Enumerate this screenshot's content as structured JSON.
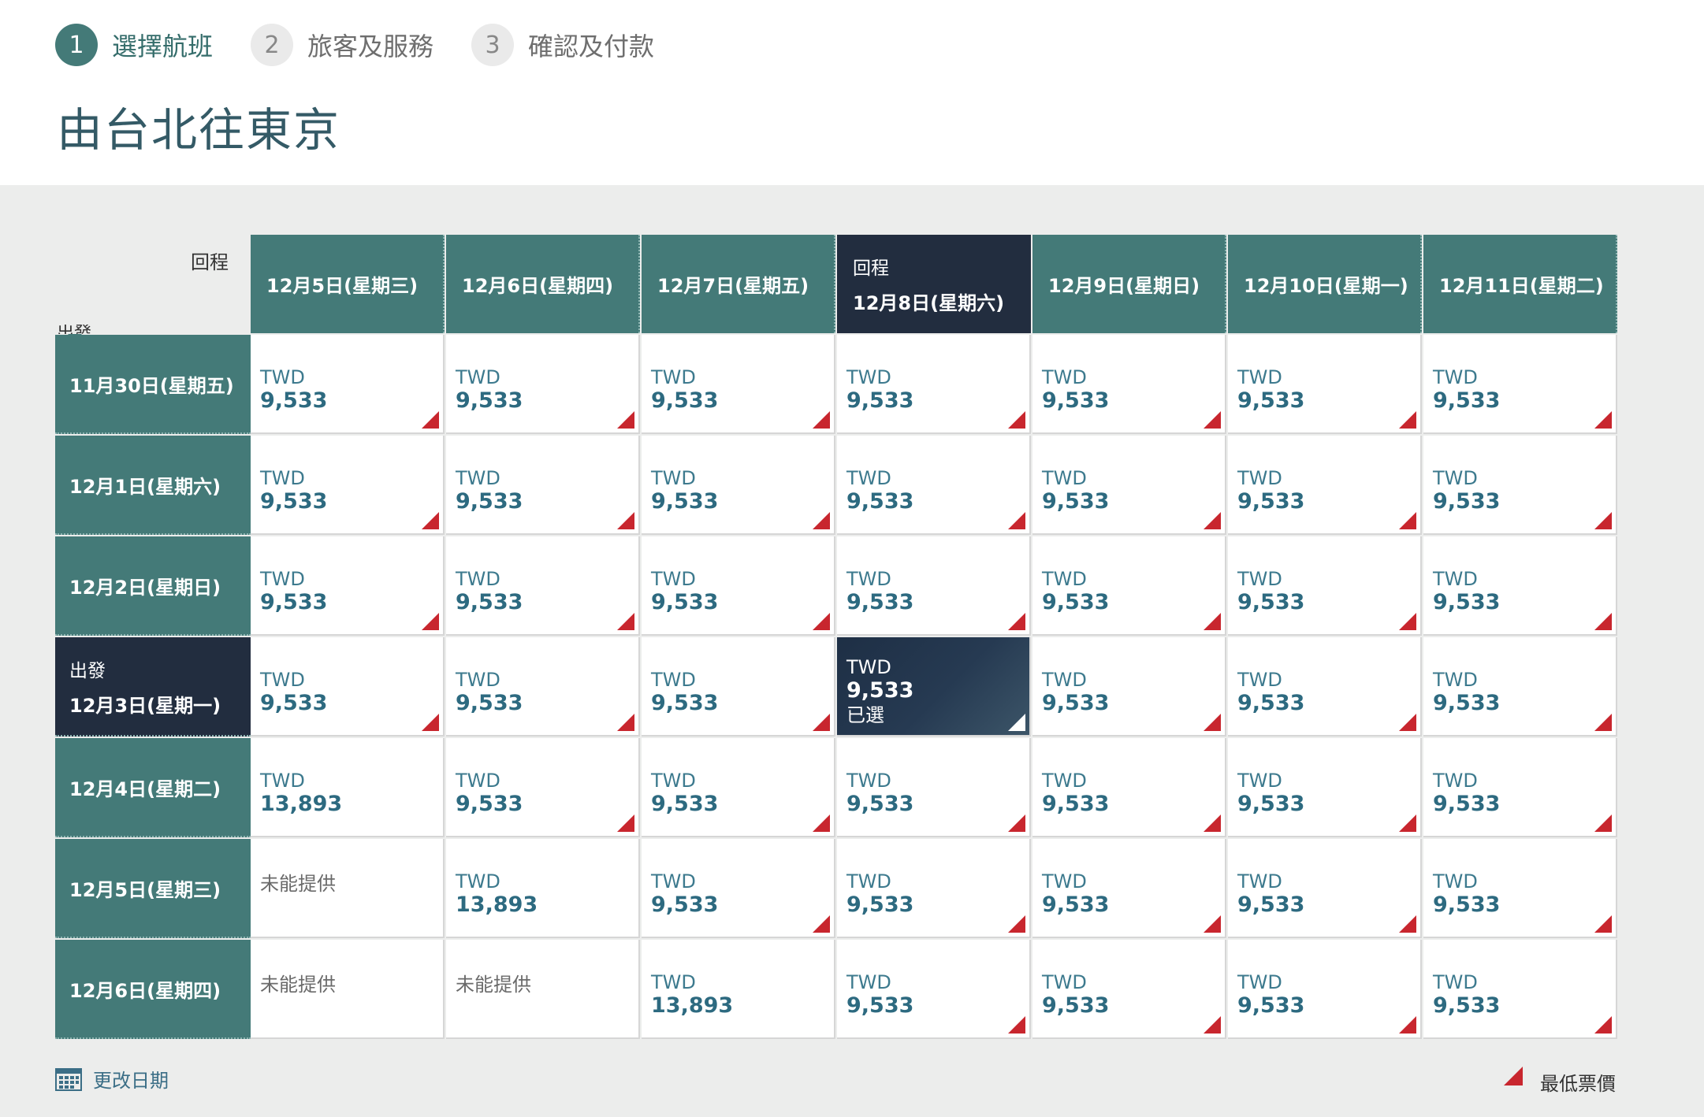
{
  "steps": [
    {
      "num": "1",
      "label": "選擇航班",
      "active": true
    },
    {
      "num": "2",
      "label": "旅客及服務",
      "active": false
    },
    {
      "num": "3",
      "label": "確認及付款",
      "active": false
    }
  ],
  "page_title": "由台北往東京",
  "axis": {
    "return_label": "回程",
    "depart_label": "出發"
  },
  "columns": [
    {
      "date": "12月5日(星期三)",
      "tag": ""
    },
    {
      "date": "12月6日(星期四)",
      "tag": ""
    },
    {
      "date": "12月7日(星期五)",
      "tag": ""
    },
    {
      "date": "12月8日(星期六)",
      "tag": "回程",
      "selected": true
    },
    {
      "date": "12月9日(星期日)",
      "tag": ""
    },
    {
      "date": "12月10日(星期一)",
      "tag": ""
    },
    {
      "date": "12月11日(星期二)",
      "tag": ""
    }
  ],
  "rows": [
    {
      "date": "11月30日(星期五)",
      "tag": "",
      "cells": [
        {
          "cur": "TWD",
          "price": "9,533",
          "lowest": true
        },
        {
          "cur": "TWD",
          "price": "9,533",
          "lowest": true
        },
        {
          "cur": "TWD",
          "price": "9,533",
          "lowest": true
        },
        {
          "cur": "TWD",
          "price": "9,533",
          "lowest": true
        },
        {
          "cur": "TWD",
          "price": "9,533",
          "lowest": true
        },
        {
          "cur": "TWD",
          "price": "9,533",
          "lowest": true
        },
        {
          "cur": "TWD",
          "price": "9,533",
          "lowest": true
        }
      ]
    },
    {
      "date": "12月1日(星期六)",
      "tag": "",
      "cells": [
        {
          "cur": "TWD",
          "price": "9,533",
          "lowest": true
        },
        {
          "cur": "TWD",
          "price": "9,533",
          "lowest": true
        },
        {
          "cur": "TWD",
          "price": "9,533",
          "lowest": true
        },
        {
          "cur": "TWD",
          "price": "9,533",
          "lowest": true
        },
        {
          "cur": "TWD",
          "price": "9,533",
          "lowest": true
        },
        {
          "cur": "TWD",
          "price": "9,533",
          "lowest": true
        },
        {
          "cur": "TWD",
          "price": "9,533",
          "lowest": true
        }
      ]
    },
    {
      "date": "12月2日(星期日)",
      "tag": "",
      "cells": [
        {
          "cur": "TWD",
          "price": "9,533",
          "lowest": true
        },
        {
          "cur": "TWD",
          "price": "9,533",
          "lowest": true
        },
        {
          "cur": "TWD",
          "price": "9,533",
          "lowest": true
        },
        {
          "cur": "TWD",
          "price": "9,533",
          "lowest": true
        },
        {
          "cur": "TWD",
          "price": "9,533",
          "lowest": true
        },
        {
          "cur": "TWD",
          "price": "9,533",
          "lowest": true
        },
        {
          "cur": "TWD",
          "price": "9,533",
          "lowest": true
        }
      ]
    },
    {
      "date": "12月3日(星期一)",
      "tag": "出發",
      "selected": true,
      "cells": [
        {
          "cur": "TWD",
          "price": "9,533",
          "lowest": true
        },
        {
          "cur": "TWD",
          "price": "9,533",
          "lowest": true
        },
        {
          "cur": "TWD",
          "price": "9,533",
          "lowest": true
        },
        {
          "cur": "TWD",
          "price": "9,533",
          "lowest": true,
          "selected": true,
          "chosen": "已選"
        },
        {
          "cur": "TWD",
          "price": "9,533",
          "lowest": true
        },
        {
          "cur": "TWD",
          "price": "9,533",
          "lowest": true
        },
        {
          "cur": "TWD",
          "price": "9,533",
          "lowest": true
        }
      ]
    },
    {
      "date": "12月4日(星期二)",
      "tag": "",
      "cells": [
        {
          "cur": "TWD",
          "price": "13,893",
          "lowest": false
        },
        {
          "cur": "TWD",
          "price": "9,533",
          "lowest": true
        },
        {
          "cur": "TWD",
          "price": "9,533",
          "lowest": true
        },
        {
          "cur": "TWD",
          "price": "9,533",
          "lowest": true
        },
        {
          "cur": "TWD",
          "price": "9,533",
          "lowest": true
        },
        {
          "cur": "TWD",
          "price": "9,533",
          "lowest": true
        },
        {
          "cur": "TWD",
          "price": "9,533",
          "lowest": true
        }
      ]
    },
    {
      "date": "12月5日(星期三)",
      "tag": "",
      "cells": [
        {
          "na": "未能提供"
        },
        {
          "cur": "TWD",
          "price": "13,893",
          "lowest": false
        },
        {
          "cur": "TWD",
          "price": "9,533",
          "lowest": true
        },
        {
          "cur": "TWD",
          "price": "9,533",
          "lowest": true
        },
        {
          "cur": "TWD",
          "price": "9,533",
          "lowest": true
        },
        {
          "cur": "TWD",
          "price": "9,533",
          "lowest": true
        },
        {
          "cur": "TWD",
          "price": "9,533",
          "lowest": true
        }
      ]
    },
    {
      "date": "12月6日(星期四)",
      "tag": "",
      "cells": [
        {
          "na": "未能提供"
        },
        {
          "na": "未能提供"
        },
        {
          "cur": "TWD",
          "price": "13,893",
          "lowest": false
        },
        {
          "cur": "TWD",
          "price": "9,533",
          "lowest": true
        },
        {
          "cur": "TWD",
          "price": "9,533",
          "lowest": true
        },
        {
          "cur": "TWD",
          "price": "9,533",
          "lowest": true
        },
        {
          "cur": "TWD",
          "price": "9,533",
          "lowest": true
        }
      ]
    }
  ],
  "footer": {
    "change_dates": "更改日期",
    "legend_lowest": "最低票價"
  },
  "colors": {
    "header_teal": "#447a78",
    "selected_navy": "#222d3f",
    "lowest_marker_red": "#c8262e"
  }
}
